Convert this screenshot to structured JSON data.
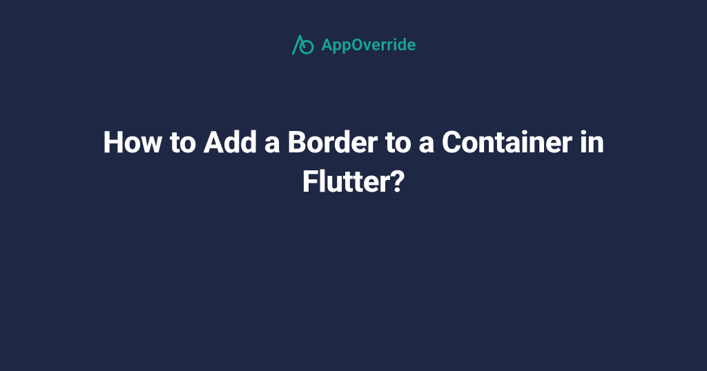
{
  "brand": {
    "name": "AppOverride",
    "accent_color": "#17a694",
    "background_color": "#1e2744",
    "text_color": "#ffffff"
  },
  "page": {
    "title": "How to Add a Border to a Container in Flutter?"
  }
}
